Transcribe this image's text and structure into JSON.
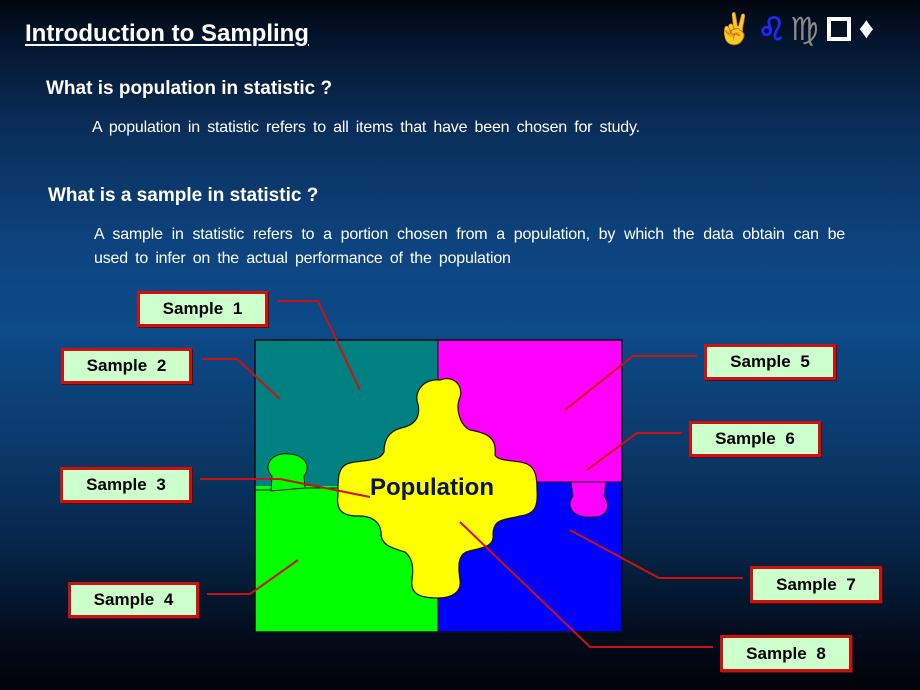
{
  "title": "Introduction to Sampling",
  "header_icons": [
    "peace-hand-icon",
    "leo-icon",
    "virgo-icon",
    "square-icon",
    "diamond-icon"
  ],
  "sections": [
    {
      "heading": "What is population in statistic ?",
      "text": "A population  in statistic refers to all items that have  been chosen  for study."
    },
    {
      "heading": "What is a sample in statistic ?",
      "text": "A sample  in statistic refers to a portion  chosen  from a population,  by which  the data obtain  can  be used  to infer  on  the actual  performance  of the population"
    }
  ],
  "diagram": {
    "center_label": "Population",
    "colors": {
      "top_left": "#008080",
      "top_right": "#ff00ff",
      "bottom_left": "#00ff00",
      "bottom_right": "#0000ff",
      "center": "#ffff00",
      "label_fill": "#ccffcc",
      "label_border": "#cc1111",
      "connector": "#cc1111"
    },
    "samples": [
      {
        "label": "Sample  1"
      },
      {
        "label": "Sample  2"
      },
      {
        "label": "Sample  3"
      },
      {
        "label": "Sample  4"
      },
      {
        "label": "Sample  5"
      },
      {
        "label": "Sample  6"
      },
      {
        "label": "Sample  7"
      },
      {
        "label": "Sample  8"
      }
    ]
  }
}
